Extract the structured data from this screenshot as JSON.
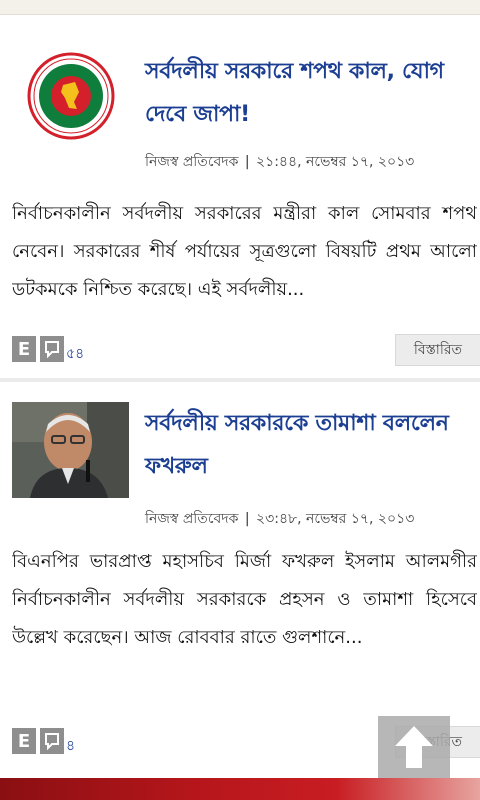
{
  "articles": [
    {
      "title": "সর্বদলীয় সরকারে শপথ কাল, যোগ দেবে জাপা!",
      "author": "নিজস্ব প্রতিবেদক",
      "datetime": "২১:৪৪, নভেম্বর ১৭, ২০১৩",
      "summary": "নির্বাচনকালীন সর্বদলীয় সরকারের মন্ত্রীরা কাল সোমবার শপথ নেবেন। সরকারের শীর্ষ পর্যায়ের সূত্রগুলো বিষয়টি প্রথম আলো ডটকমকে নিশ্চিত করেছে। এই সর্বদলীয়...",
      "comment_count": "৫৪",
      "details_label": "বিস্তারিত",
      "thumb_icon": "government-seal-logo"
    },
    {
      "title": "সর্বদলীয় সরকারকে তামাশা বললেন ফখরুল",
      "author": "নিজস্ব প্রতিবেদক",
      "datetime": "২৩:৪৮, নভেম্বর ১৭, ২০১৩",
      "summary": "বিএনপির ভারপ্রাপ্ত মহাসচিব মির্জা ফখরুল ইসলাম আলমগীর নির্বাচনকালীন সর্বদলীয় সরকারকে প্রহসন ও তামাশা হিসেবে উল্লেখ করেছেন। আজ রোববার রাতে গুলশানে...",
      "comment_count": "৪",
      "details_label": "বিস্তারিত",
      "thumb_icon": "person-photo"
    }
  ],
  "action_icons": {
    "e_label": "E",
    "comment_icon": "comment-icon"
  },
  "scroll_top_icon": "arrow-up-icon",
  "colors": {
    "headline": "#1c3f93",
    "seal_red": "#d3202a",
    "seal_green": "#0f7d3c"
  }
}
